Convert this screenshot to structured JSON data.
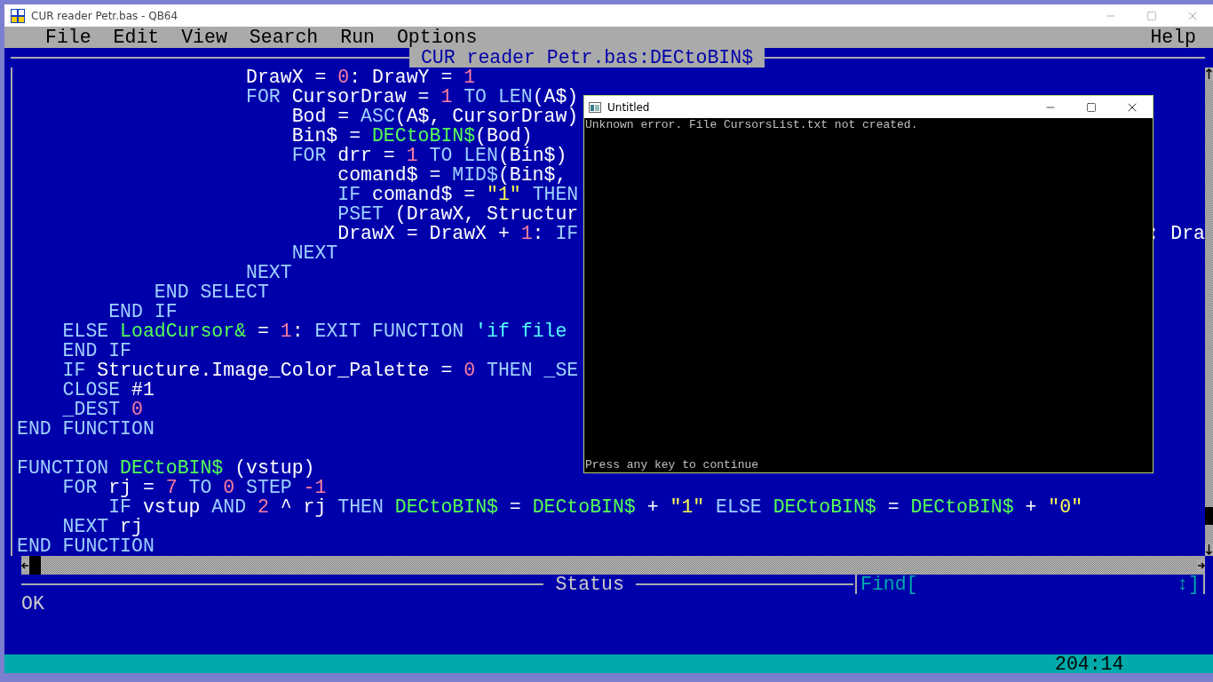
{
  "window": {
    "title": "CUR reader Petr.bas - QB64"
  },
  "menu": [
    {
      "label": "File"
    },
    {
      "label": "Edit"
    },
    {
      "label": "View"
    },
    {
      "label": "Search"
    },
    {
      "label": "Run"
    },
    {
      "label": "Options"
    }
  ],
  "menu_right": {
    "label": "Help"
  },
  "editor": {
    "title": "CUR reader Petr.bas:DECtoBIN$",
    "lines": [
      {
        "kind": "code",
        "tokens": [
          {
            "kind": "id",
            "text": "                    DrawX = "
          },
          {
            "kind": "num",
            "text": "0"
          },
          {
            "kind": "id",
            "text": ": DrawY = "
          },
          {
            "kind": "num",
            "text": "1"
          }
        ]
      },
      {
        "kind": "code",
        "tokens": [
          {
            "kind": "kw",
            "text": "                    FOR"
          },
          {
            "kind": "id",
            "text": " CursorDraw = "
          },
          {
            "kind": "num",
            "text": "1"
          },
          {
            "kind": "kw",
            "text": " TO LEN"
          },
          {
            "kind": "id",
            "text": "(A$)"
          }
        ]
      },
      {
        "kind": "code",
        "tokens": [
          {
            "kind": "id",
            "text": "                        Bod = "
          },
          {
            "kind": "kw",
            "text": "ASC"
          },
          {
            "kind": "id",
            "text": "(A$, CursorDraw)"
          }
        ]
      },
      {
        "kind": "code",
        "tokens": [
          {
            "kind": "id",
            "text": "                        Bin$ = "
          },
          {
            "kind": "fn",
            "text": "DECtoBIN$"
          },
          {
            "kind": "id",
            "text": "(Bod)"
          }
        ]
      },
      {
        "kind": "code",
        "tokens": [
          {
            "kind": "kw",
            "text": "                        FOR"
          },
          {
            "kind": "id",
            "text": " drr = "
          },
          {
            "kind": "num",
            "text": "1"
          },
          {
            "kind": "kw",
            "text": " TO LEN"
          },
          {
            "kind": "id",
            "text": "(Bin$)"
          }
        ]
      },
      {
        "kind": "code",
        "tokens": [
          {
            "kind": "id",
            "text": "                            comand$ = "
          },
          {
            "kind": "kw",
            "text": "MID$"
          },
          {
            "kind": "id",
            "text": "(Bin$,"
          }
        ]
      },
      {
        "kind": "code",
        "tokens": [
          {
            "kind": "kw",
            "text": "                            IF"
          },
          {
            "kind": "id",
            "text": " comand$ = "
          },
          {
            "kind": "str",
            "text": "\"1\""
          },
          {
            "kind": "kw",
            "text": " THEN"
          }
        ]
      },
      {
        "kind": "code",
        "tokens": [
          {
            "kind": "kw",
            "text": "                            PSET"
          },
          {
            "kind": "id",
            "text": " (DrawX, Structur"
          }
        ]
      },
      {
        "kind": "code",
        "tokens": [
          {
            "kind": "id",
            "text": "                            DrawX = DrawX + "
          },
          {
            "kind": "num",
            "text": "1"
          },
          {
            "kind": "id",
            "text": ": "
          },
          {
            "kind": "kw",
            "text": "IF"
          }
        ],
        "tail": [
          {
            "kind": "id",
            "text": ": Dra"
          }
        ]
      },
      {
        "kind": "code",
        "tokens": [
          {
            "kind": "kw",
            "text": "                        NEXT"
          }
        ]
      },
      {
        "kind": "code",
        "tokens": [
          {
            "kind": "kw",
            "text": "                    NEXT"
          }
        ]
      },
      {
        "kind": "code",
        "tokens": [
          {
            "kind": "kw",
            "text": "            END SELECT"
          }
        ]
      },
      {
        "kind": "code",
        "tokens": [
          {
            "kind": "kw",
            "text": "        END IF"
          }
        ]
      },
      {
        "kind": "code",
        "tokens": [
          {
            "kind": "kw",
            "text": "    ELSE"
          },
          {
            "kind": "fn",
            "text": " LoadCursor&"
          },
          {
            "kind": "id",
            "text": " = "
          },
          {
            "kind": "num",
            "text": "1"
          },
          {
            "kind": "id",
            "text": ": "
          },
          {
            "kind": "kw",
            "text": "EXIT FUNCTION"
          },
          {
            "kind": "cm",
            "text": " 'if file"
          }
        ]
      },
      {
        "kind": "code",
        "tokens": [
          {
            "kind": "kw",
            "text": "    END IF"
          }
        ]
      },
      {
        "kind": "code",
        "tokens": [
          {
            "kind": "kw",
            "text": "    IF"
          },
          {
            "kind": "id",
            "text": " Structure.Image_Color_Palette = "
          },
          {
            "kind": "num",
            "text": "0"
          },
          {
            "kind": "kw",
            "text": " THEN _SE"
          }
        ]
      },
      {
        "kind": "code",
        "tokens": [
          {
            "kind": "kw",
            "text": "    CLOSE"
          },
          {
            "kind": "id",
            "text": " #1"
          }
        ]
      },
      {
        "kind": "code",
        "tokens": [
          {
            "kind": "kw",
            "text": "    _DEST"
          },
          {
            "kind": "num",
            "text": " 0"
          }
        ]
      },
      {
        "kind": "code",
        "tokens": [
          {
            "kind": "kw",
            "text": "END FUNCTION"
          }
        ]
      },
      {
        "kind": "blank"
      },
      {
        "kind": "code",
        "tokens": [
          {
            "kind": "kw",
            "text": "FUNCTION"
          },
          {
            "kind": "fn",
            "text": " DECtoBIN$"
          },
          {
            "kind": "id",
            "text": " (vstup)"
          }
        ]
      },
      {
        "kind": "code",
        "tokens": [
          {
            "kind": "kw",
            "text": "    FOR"
          },
          {
            "kind": "id",
            "text": " rj = "
          },
          {
            "kind": "num",
            "text": "7"
          },
          {
            "kind": "kw",
            "text": " TO "
          },
          {
            "kind": "num",
            "text": "0"
          },
          {
            "kind": "kw",
            "text": " STEP "
          },
          {
            "kind": "num",
            "text": "-1"
          }
        ]
      },
      {
        "kind": "code",
        "tokens": [
          {
            "kind": "kw",
            "text": "        IF"
          },
          {
            "kind": "id",
            "text": " vstup "
          },
          {
            "kind": "kw",
            "text": "AND "
          },
          {
            "kind": "num",
            "text": "2"
          },
          {
            "kind": "id",
            "text": " ^ rj "
          },
          {
            "kind": "kw",
            "text": "THEN "
          },
          {
            "kind": "fn",
            "text": "DECtoBIN$"
          },
          {
            "kind": "id",
            "text": " = "
          },
          {
            "kind": "fn",
            "text": "DECtoBIN$"
          },
          {
            "kind": "id",
            "text": " + "
          },
          {
            "kind": "str",
            "text": "\"1\""
          },
          {
            "kind": "kw",
            "text": " ELSE "
          },
          {
            "kind": "fn",
            "text": "DECtoBIN$"
          },
          {
            "kind": "id",
            "text": " = "
          },
          {
            "kind": "fn",
            "text": "DECtoBIN$"
          },
          {
            "kind": "id",
            "text": " + "
          },
          {
            "kind": "str",
            "text": "\"0\""
          }
        ]
      },
      {
        "kind": "code",
        "tokens": [
          {
            "kind": "kw",
            "text": "    NEXT"
          },
          {
            "kind": "id",
            "text": " rj"
          }
        ]
      },
      {
        "kind": "code",
        "tokens": [
          {
            "kind": "kw",
            "text": "END FUNCTION"
          }
        ]
      }
    ]
  },
  "status": {
    "title": "Status",
    "find_label": "Find[",
    "find_end": "↕]",
    "message": "OK"
  },
  "position": "204:14",
  "output_window": {
    "title": "Untitled",
    "lines": [
      "Unknown error. File CursorsList.txt not created."
    ],
    "footer": "Press any key to continue"
  }
}
